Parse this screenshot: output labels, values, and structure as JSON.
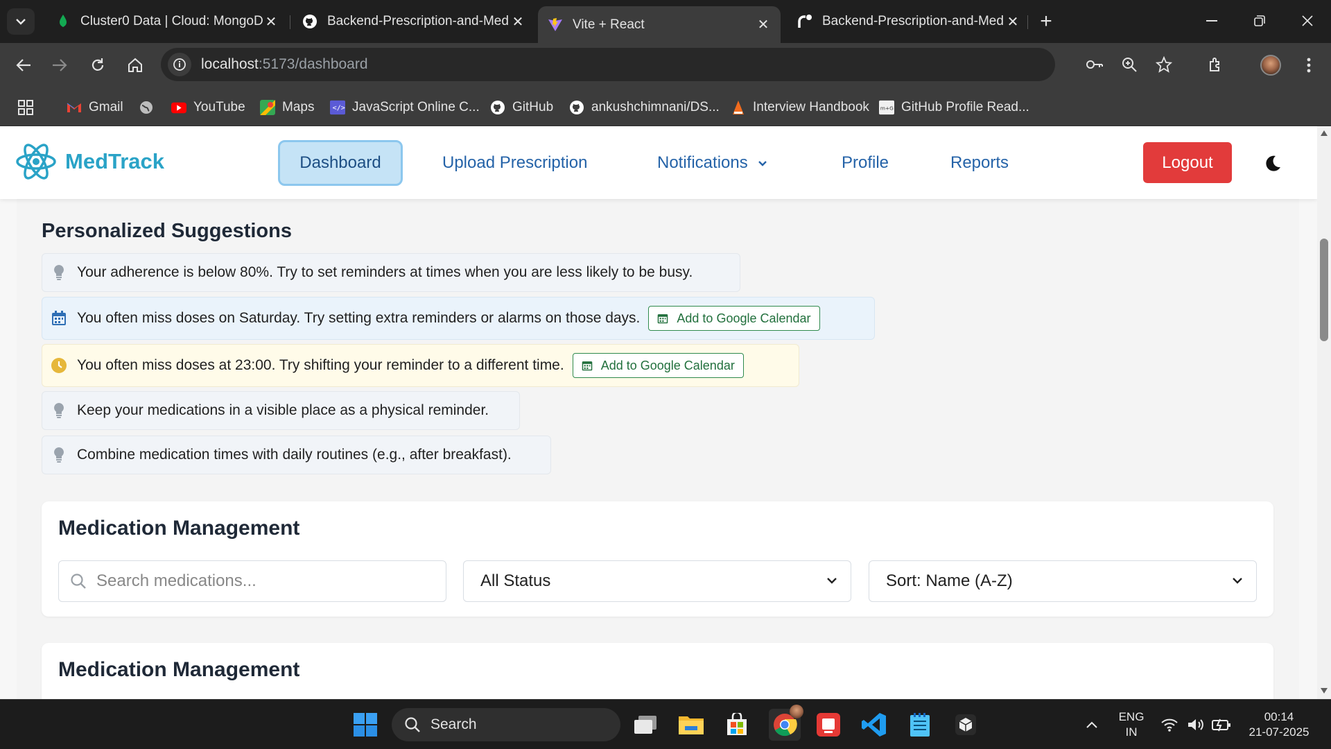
{
  "browser": {
    "tabs": [
      {
        "title": "Cluster0 Data | Cloud: MongoDB",
        "icon": "mongodb-leaf-icon"
      },
      {
        "title": "Backend-Prescription-and-Med",
        "icon": "github-icon"
      },
      {
        "title": "Vite + React",
        "icon": "vite-icon",
        "active": true
      },
      {
        "title": "Backend-Prescription-and-Med",
        "icon": "render-icon"
      }
    ],
    "url_host": "localhost",
    "url_path": ":5173/dashboard",
    "bookmarks": [
      {
        "label": "Gmail",
        "icon": "gmail-icon"
      },
      {
        "label": "",
        "icon": "globe-icon"
      },
      {
        "label": "YouTube",
        "icon": "youtube-icon"
      },
      {
        "label": "Maps",
        "icon": "maps-icon"
      },
      {
        "label": "JavaScript Online C...",
        "icon": "code-icon"
      },
      {
        "label": "GitHub",
        "icon": "github-icon"
      },
      {
        "label": "ankushchimnani/DS...",
        "icon": "github-icon"
      },
      {
        "label": "Interview Handbook",
        "icon": "handbook-icon"
      },
      {
        "label": "GitHub Profile Read...",
        "icon": "readme-icon"
      }
    ]
  },
  "app": {
    "brand": "MedTrack",
    "nav": {
      "dashboard": "Dashboard",
      "upload": "Upload Prescription",
      "notifications": "Notifications",
      "profile": "Profile",
      "reports": "Reports",
      "logout": "Logout"
    },
    "suggestions": {
      "title": "Personalized Suggestions",
      "items": [
        {
          "text": "Your adherence is below 80%. Try to set reminders at times when you are less likely to be busy.",
          "icon": "lightbulb-icon"
        },
        {
          "text": "You often miss doses on Saturday. Try setting extra reminders or alarms on those days.",
          "icon": "calendar-icon",
          "action": "Add to Google Calendar"
        },
        {
          "text": "You often miss doses at 23:00. Try shifting your reminder to a different time.",
          "icon": "clock-icon",
          "action": "Add to Google Calendar"
        },
        {
          "text": "Keep your medications in a visible place as a physical reminder.",
          "icon": "lightbulb-icon"
        },
        {
          "text": "Combine medication times with daily routines (e.g., after breakfast).",
          "icon": "lightbulb-icon"
        }
      ]
    },
    "medication": {
      "title": "Medication Management",
      "search_placeholder": "Search medications...",
      "status_value": "All Status",
      "sort_value": "Sort: Name (A-Z)",
      "second_title": "Medication Management"
    },
    "colors": {
      "accent": "#2aa3c7",
      "nav_link": "#2563a8",
      "logout": "#e23b3b",
      "calendar_green": "#22703d"
    }
  },
  "taskbar": {
    "search_label": "Search",
    "lang_top": "ENG",
    "lang_bottom": "IN",
    "time": "00:14",
    "date": "21-07-2025"
  }
}
